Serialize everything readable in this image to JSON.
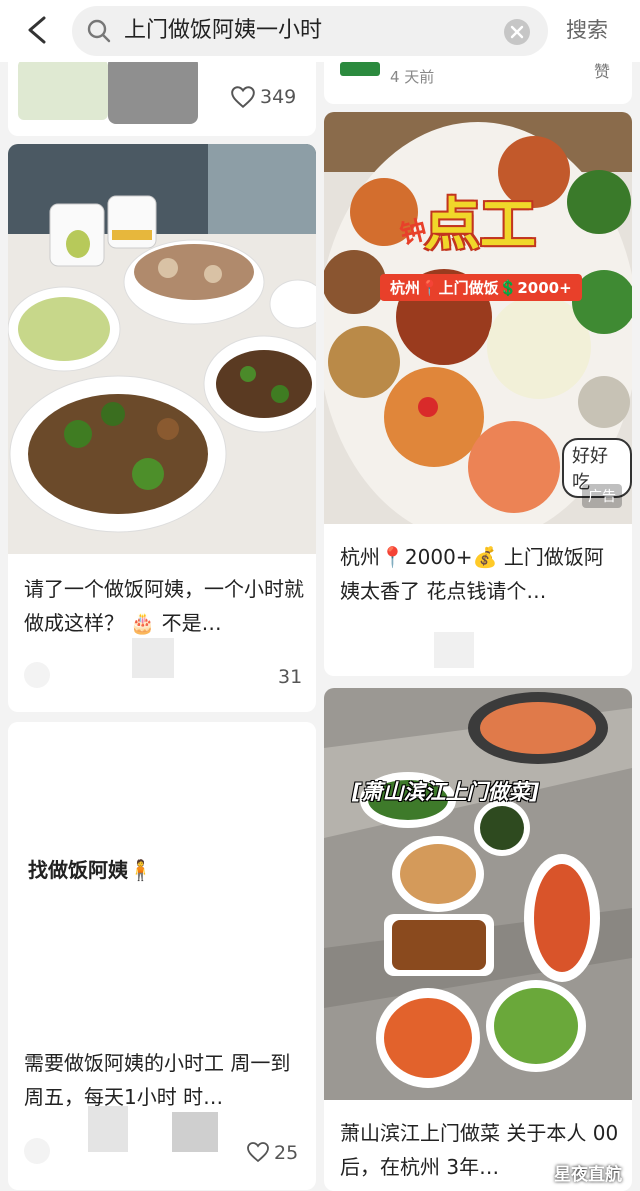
{
  "search": {
    "query": "上门做饭阿姨一小时",
    "button": "搜索"
  },
  "cards": {
    "top_left": {
      "likes": "349"
    },
    "top_right": {
      "time": "4 天前",
      "right_label": "赞"
    },
    "c1": {
      "title": "请了一个做饭阿姨，一个小时就做成这样？ 🎂 不是…",
      "likes": "31"
    },
    "c2": {
      "overlay_big": "点工",
      "overlay_small": "钟",
      "overlay_banner": "杭州📍上门做饭💲2000+",
      "overlay_tag": "好好吃",
      "ad": "广告",
      "title": "杭州📍2000+💰 上门做饭阿姨太香了 花点钱请个…"
    },
    "c3": {
      "body": "找做饭阿姨🧍",
      "title": "需要做饭阿姨的小时工 周一到周五，每天1小时 时…",
      "likes": "25"
    },
    "c4": {
      "overlay": "[萧山滨江上门做菜]",
      "title": "萧山滨江上门做菜 关于本人 00后，在杭州 3年…",
      "watermark": "星夜直航"
    }
  },
  "colors": {
    "accent_red": "#e8402a",
    "background": "#f3f3f3",
    "card": "#ffffff"
  },
  "icons": [
    "back-arrow-icon",
    "search-icon",
    "clear-icon",
    "heart-icon"
  ]
}
